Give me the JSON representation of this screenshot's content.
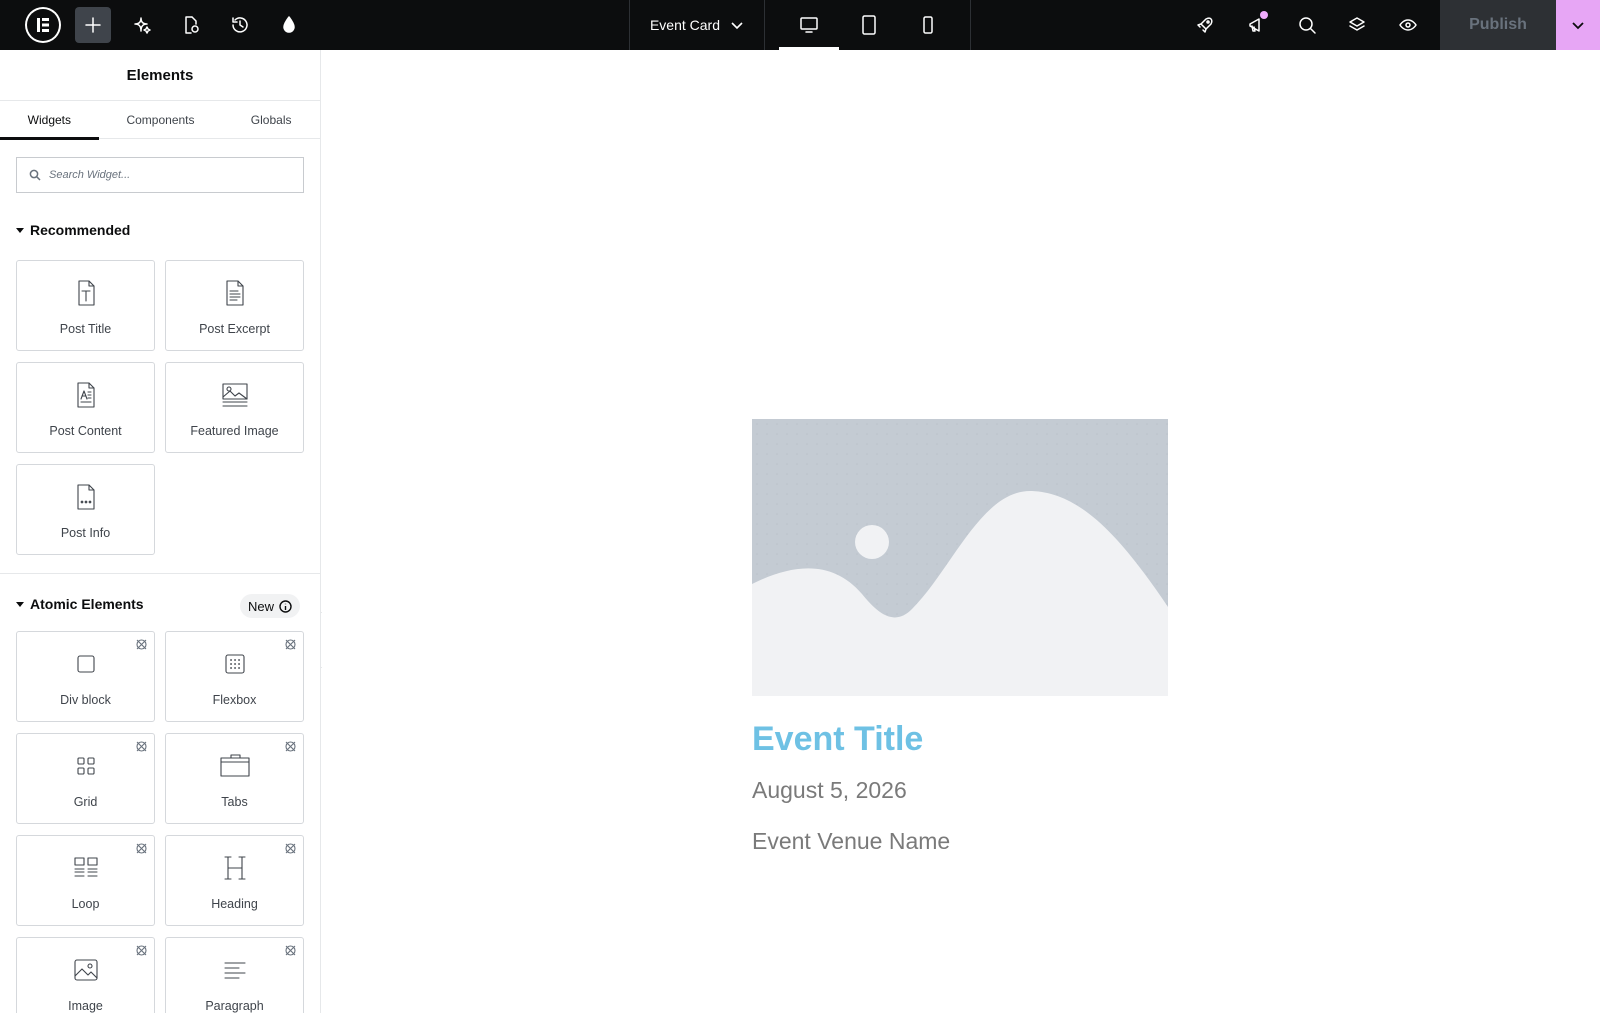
{
  "topbar": {
    "document_title": "Event Card",
    "publish_label": "Publish",
    "icons": [
      "elementor-logo-icon",
      "plus-icon",
      "ai-sparkle-icon",
      "page-settings-icon",
      "history-icon",
      "site-style-icon",
      "rocket-icon",
      "megaphone-icon",
      "search-icon",
      "layers-icon",
      "eye-icon",
      "chevron-down-icon"
    ],
    "devices": [
      "desktop",
      "tablet",
      "mobile"
    ],
    "active_device": "desktop",
    "accent_color": "#e7a6f5"
  },
  "panel": {
    "title": "Elements",
    "tabs": [
      {
        "label": "Widgets",
        "active": true
      },
      {
        "label": "Components",
        "active": false
      },
      {
        "label": "Globals",
        "active": false
      }
    ],
    "search": {
      "placeholder": "Search Widget...",
      "value": ""
    },
    "recommended": {
      "title": "Recommended",
      "items": [
        {
          "label": "Post Title",
          "icon": "post-title-icon"
        },
        {
          "label": "Post Excerpt",
          "icon": "post-excerpt-icon"
        },
        {
          "label": "Post Content",
          "icon": "post-content-icon"
        },
        {
          "label": "Featured Image",
          "icon": "featured-image-icon"
        },
        {
          "label": "Post Info",
          "icon": "post-info-icon"
        }
      ]
    },
    "atomic": {
      "title": "Atomic Elements",
      "badge": "New",
      "items": [
        {
          "label": "Div block",
          "icon": "div-block-icon"
        },
        {
          "label": "Flexbox",
          "icon": "flexbox-icon"
        },
        {
          "label": "Grid",
          "icon": "grid-icon"
        },
        {
          "label": "Tabs",
          "icon": "tabs-icon"
        },
        {
          "label": "Loop",
          "icon": "loop-icon"
        },
        {
          "label": "Heading",
          "icon": "heading-icon"
        },
        {
          "label": "Image",
          "icon": "image-icon"
        },
        {
          "label": "Paragraph",
          "icon": "paragraph-icon"
        }
      ]
    }
  },
  "canvas": {
    "card": {
      "title": "Event Title",
      "date": "August 5, 2026",
      "venue": "Event Venue Name",
      "title_color": "#6ec1e4",
      "text_color": "#7a7a7a"
    }
  }
}
